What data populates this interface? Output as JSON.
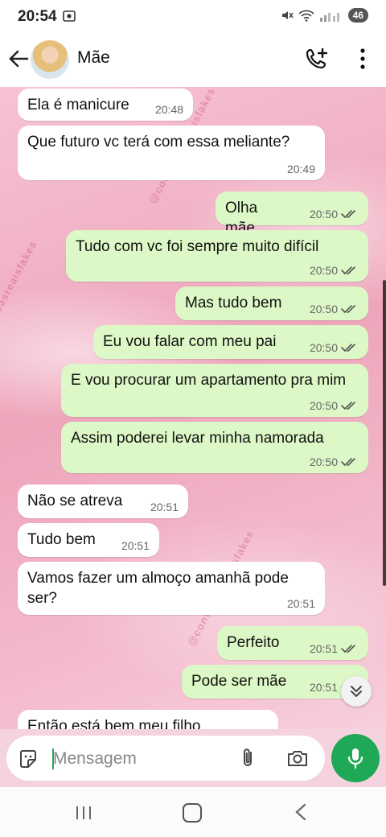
{
  "status": {
    "time": "20:54",
    "battery": "46"
  },
  "header": {
    "contact_name": "Mãe"
  },
  "watermark": "@conversasreaisfakes",
  "messages": [
    {
      "dir": "in",
      "text": "Ela é manicure",
      "time": "20:48"
    },
    {
      "dir": "in",
      "text": "Que futuro vc terá com essa meliante?",
      "time": "20:49"
    },
    {
      "dir": "out",
      "text": "Olha mãe",
      "time": "20:50"
    },
    {
      "dir": "out",
      "text": "Tudo com vc foi sempre muito difícil",
      "time": "20:50"
    },
    {
      "dir": "out",
      "text": "Mas tudo bem",
      "time": "20:50"
    },
    {
      "dir": "out",
      "text": "Eu vou falar com meu pai",
      "time": "20:50"
    },
    {
      "dir": "out",
      "text": "E vou procurar um apartamento pra mim",
      "time": "20:50"
    },
    {
      "dir": "out",
      "text": "Assim poderei levar minha namorada",
      "time": "20:50"
    },
    {
      "dir": "in",
      "text": "Não se atreva",
      "time": "20:51"
    },
    {
      "dir": "in",
      "text": "Tudo bem",
      "time": "20:51"
    },
    {
      "dir": "in",
      "text": "Vamos fazer um almoço amanhã pode ser?",
      "time": "20:51"
    },
    {
      "dir": "out",
      "text": "Perfeito",
      "time": "20:51"
    },
    {
      "dir": "out",
      "text": "Pode ser mãe",
      "time": "20:51"
    },
    {
      "dir": "in",
      "text": "Então está bem meu filho",
      "time": ""
    }
  ],
  "input": {
    "placeholder": "Mensagem"
  },
  "colors": {
    "incoming": "#ffffff",
    "outgoing": "#dcf8c6",
    "accent": "#1fa855",
    "ticks": "#555555"
  }
}
